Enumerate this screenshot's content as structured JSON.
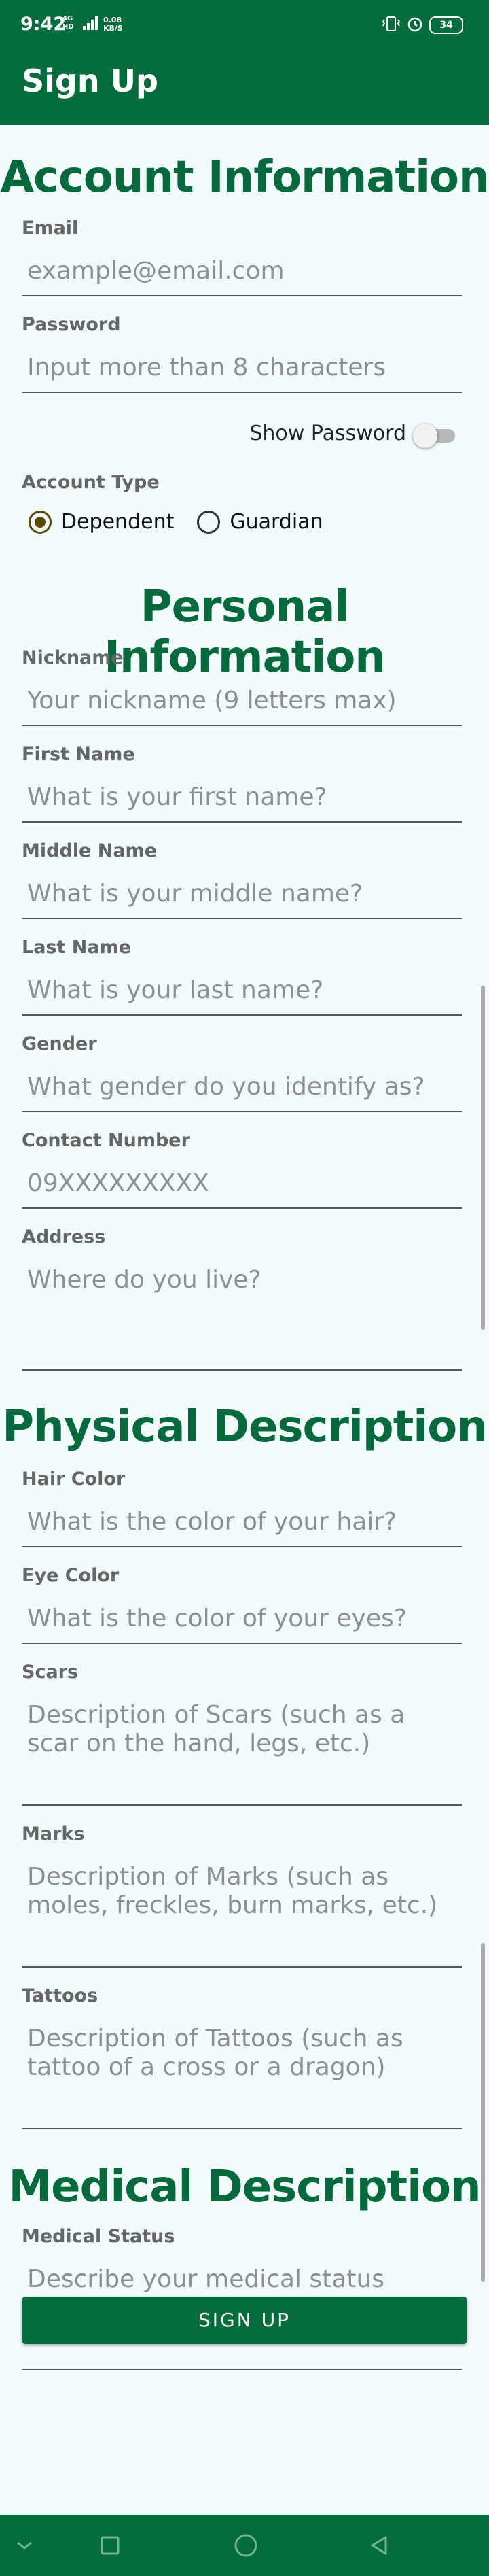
{
  "status_bar": {
    "time": "9:42",
    "net_type_top": "4G",
    "net_type_bottom": "HD",
    "speed_value": "0.08",
    "speed_unit": "KB/S",
    "battery": "34",
    "icons": [
      "signal-icon",
      "vibrate-icon",
      "alarm-icon",
      "battery-icon"
    ]
  },
  "app_bar": {
    "title": "Sign Up"
  },
  "sections": {
    "account": "Account Information",
    "personal": "Personal Information",
    "physical": "Physical Description",
    "medical": "Medical Description"
  },
  "fields": {
    "email": {
      "label": "Email",
      "placeholder": "example@email.com",
      "value": ""
    },
    "password": {
      "label": "Password",
      "placeholder": "Input more than 8 characters",
      "value": ""
    },
    "nickname": {
      "label": "Nickname",
      "placeholder": "Your nickname (9 letters max)",
      "value": ""
    },
    "first_name": {
      "label": "First Name",
      "placeholder": "What is your first name?",
      "value": ""
    },
    "middle_name": {
      "label": "Middle Name",
      "placeholder": "What is your middle name?",
      "value": ""
    },
    "last_name": {
      "label": "Last Name",
      "placeholder": "What is your last name?",
      "value": ""
    },
    "gender": {
      "label": "Gender",
      "placeholder": "What gender do you identify as?",
      "value": ""
    },
    "contact": {
      "label": "Contact Number",
      "placeholder": "09XXXXXXXXX",
      "value": ""
    },
    "address": {
      "label": "Address",
      "placeholder": "Where do you live?",
      "value": ""
    },
    "hair_color": {
      "label": "Hair Color",
      "placeholder": "What is the color of your hair?",
      "value": ""
    },
    "eye_color": {
      "label": "Eye Color",
      "placeholder": "What is the color of your eyes?",
      "value": ""
    },
    "scars": {
      "label": "Scars",
      "placeholder": "Description of Scars (such as a scar on the hand, legs, etc.)",
      "value": ""
    },
    "marks": {
      "label": "Marks",
      "placeholder": "Description of Marks (such as moles, freckles, burn marks, etc.)",
      "value": ""
    },
    "tattoos": {
      "label": "Tattoos",
      "placeholder": "Description of Tattoos (such as tattoo of a cross or a dragon)",
      "value": ""
    },
    "medical_status": {
      "label": "Medical Status",
      "placeholder": "Describe your medical status",
      "value": ""
    }
  },
  "show_password": {
    "label": "Show Password",
    "on": false
  },
  "account_type": {
    "label": "Account Type",
    "options": [
      "Dependent",
      "Guardian"
    ],
    "selected": "Dependent"
  },
  "signup_button": "SIGN UP",
  "nav_bar": {
    "icons": [
      "chevron-down-icon",
      "recents-square-icon",
      "home-circle-icon",
      "back-triangle-icon"
    ]
  },
  "colors": {
    "primary": "#056c3c",
    "section_title": "#076a3d",
    "background": "#f2fbfb",
    "radio_selected": "#5a4a00"
  }
}
